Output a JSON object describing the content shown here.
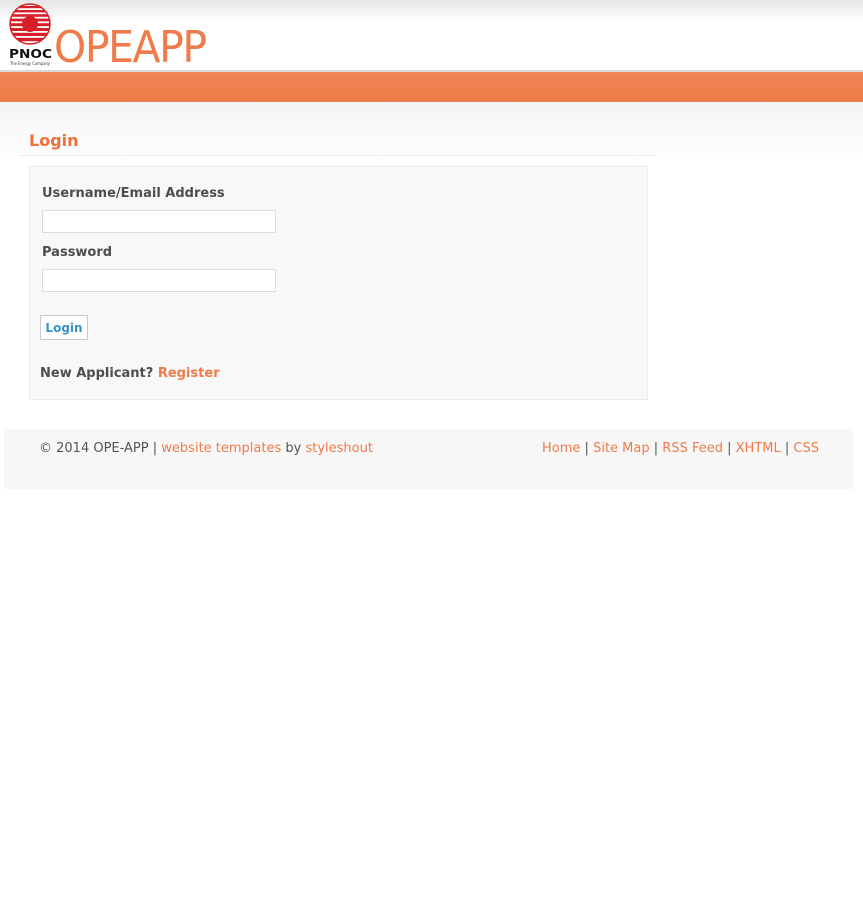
{
  "brand": {
    "title": "OPEAPP",
    "logo_text": "PNOC",
    "logo_tagline": "The Energy Company",
    "accent_color": "#ef7b4a"
  },
  "login": {
    "heading": "Login",
    "username_label": "Username/Email Address",
    "username_value": "",
    "password_label": "Password",
    "password_value": "",
    "submit_label": "Login",
    "new_applicant_text": "New Applicant?",
    "register_link": "Register"
  },
  "footer": {
    "copyright": "© 2014 OPE-APP",
    "sep1": "|",
    "templates_link": "website templates",
    "by_text": "by",
    "author_link": "styleshout",
    "links": [
      "Home",
      "Site Map",
      "RSS Feed",
      "XHTML",
      "CSS"
    ],
    "separator": "|"
  }
}
